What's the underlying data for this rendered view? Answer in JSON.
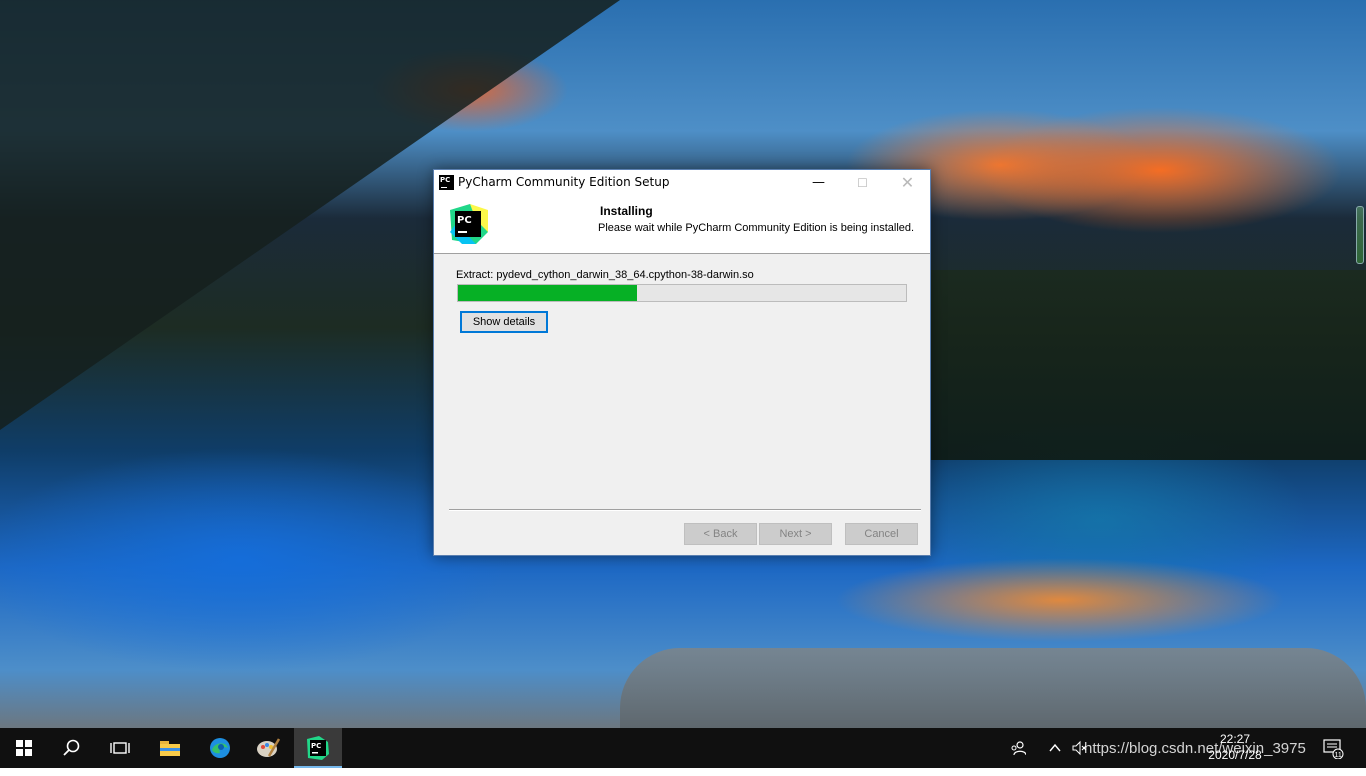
{
  "window": {
    "title": "PyCharm Community Edition Setup",
    "title_icon_text": "PC"
  },
  "header": {
    "title": "Installing",
    "subtitle": "Please wait while PyCharm Community Edition is being installed.",
    "logo_text": "PC"
  },
  "main": {
    "status_text": "Extract: pydevd_cython_darwin_38_64.cpython-38-darwin.so",
    "progress_fraction": 0.4,
    "show_details_label": "Show details"
  },
  "footer": {
    "back_label": "< Back",
    "next_label": "Next >",
    "cancel_label": "Cancel"
  },
  "taskbar": {
    "apps": [
      "start-icon",
      "search-icon",
      "task-view-icon",
      "file-explorer-icon",
      "edge-icon",
      "paint-icon",
      "pycharm-icon"
    ],
    "time": "22:27",
    "date": "2020/7/28",
    "notification_count": "11"
  },
  "watermark": "https://blog.csdn.net/weixin_3975"
}
